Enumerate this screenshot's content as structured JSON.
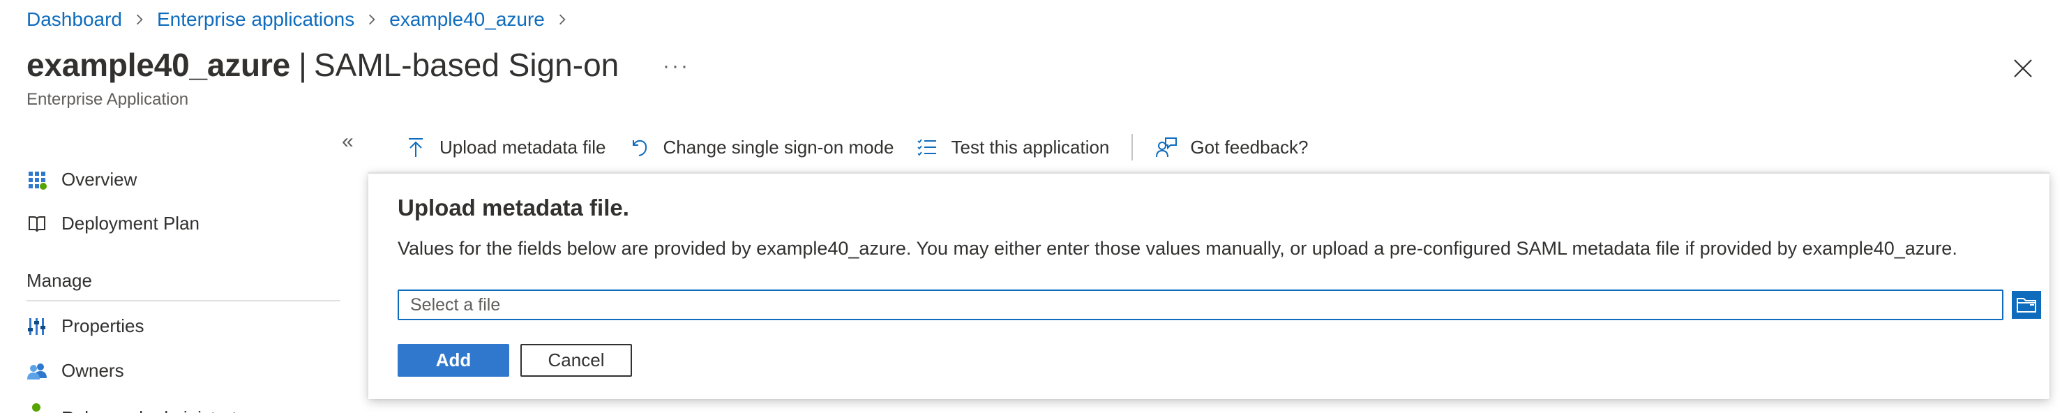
{
  "breadcrumb": {
    "items": [
      "Dashboard",
      "Enterprise applications",
      "example40_azure"
    ]
  },
  "header": {
    "app_name": "example40_azure",
    "separator": "|",
    "page_name": "SAML-based Sign-on",
    "more": "···",
    "subtitle": "Enterprise Application"
  },
  "sidebar": {
    "collapse": "«",
    "items": [
      {
        "label": "Overview",
        "icon": "grid-icon"
      },
      {
        "label": "Deployment Plan",
        "icon": "book-icon"
      }
    ],
    "section": "Manage",
    "manage_items": [
      {
        "label": "Properties",
        "icon": "sliders-icon"
      },
      {
        "label": "Owners",
        "icon": "people-icon"
      },
      {
        "label": "Roles and administrators",
        "icon": "person-icon"
      }
    ]
  },
  "toolbar": {
    "upload": "Upload metadata file",
    "change_mode": "Change single sign-on mode",
    "test": "Test this application",
    "feedback": "Got feedback?"
  },
  "panel": {
    "title": "Upload metadata file.",
    "description": "Values for the fields below are provided by example40_azure. You may either enter those values manually, or upload a pre-configured SAML metadata file if provided by example40_azure.",
    "file_placeholder": "Select a file",
    "add_label": "Add",
    "cancel_label": "Cancel"
  },
  "colors": {
    "accent": "#0f6cbd",
    "primary_button": "#2f78cd",
    "text": "#323130"
  }
}
